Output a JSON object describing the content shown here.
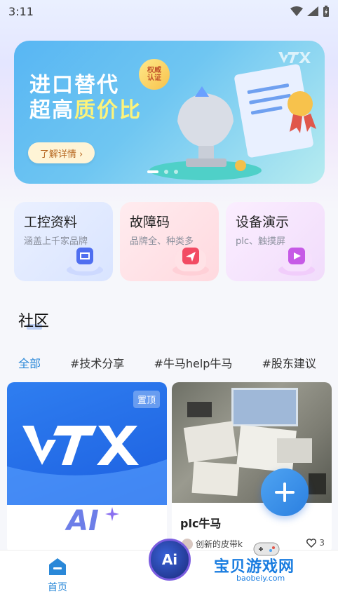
{
  "status_bar": {
    "time": "3:11"
  },
  "banner": {
    "title_line1": "进口替代",
    "title_line2_a": "超高",
    "title_line2_b": "质价比",
    "badge_line1": "权威",
    "badge_line2": "认证",
    "button_label": "了解详情 ›",
    "page_count": 3,
    "active_page": 1
  },
  "feature_cards": [
    {
      "title": "工控资料",
      "subtitle": "涵盖上千家品牌",
      "icon": "book-icon",
      "accent": "#4f6ef0"
    },
    {
      "title": "故障码",
      "subtitle": "品牌全、种类多",
      "icon": "send-icon",
      "accent": "#f24b63"
    },
    {
      "title": "设备演示",
      "subtitle": "plc、触摸屏",
      "icon": "play-icon",
      "accent": "#c65ae6"
    }
  ],
  "community": {
    "title": "社区",
    "tabs": [
      "全部",
      "#技术分享",
      "#牛马help牛马",
      "#股东建议"
    ],
    "active_tab": 0
  },
  "posts": {
    "left": {
      "pin_label": "置顶",
      "ai_text": "AI"
    },
    "right": {
      "title": "plc牛马",
      "author": "创新的皮带k",
      "likes": "3"
    }
  },
  "bottom_nav": {
    "home_label": "首页",
    "ai_label": "Ai"
  },
  "watermark": {
    "text": "宝贝游戏网",
    "url": "baobeiy.com"
  },
  "colors": {
    "accent": "#2a88d8",
    "banner": "#58b6f3"
  }
}
